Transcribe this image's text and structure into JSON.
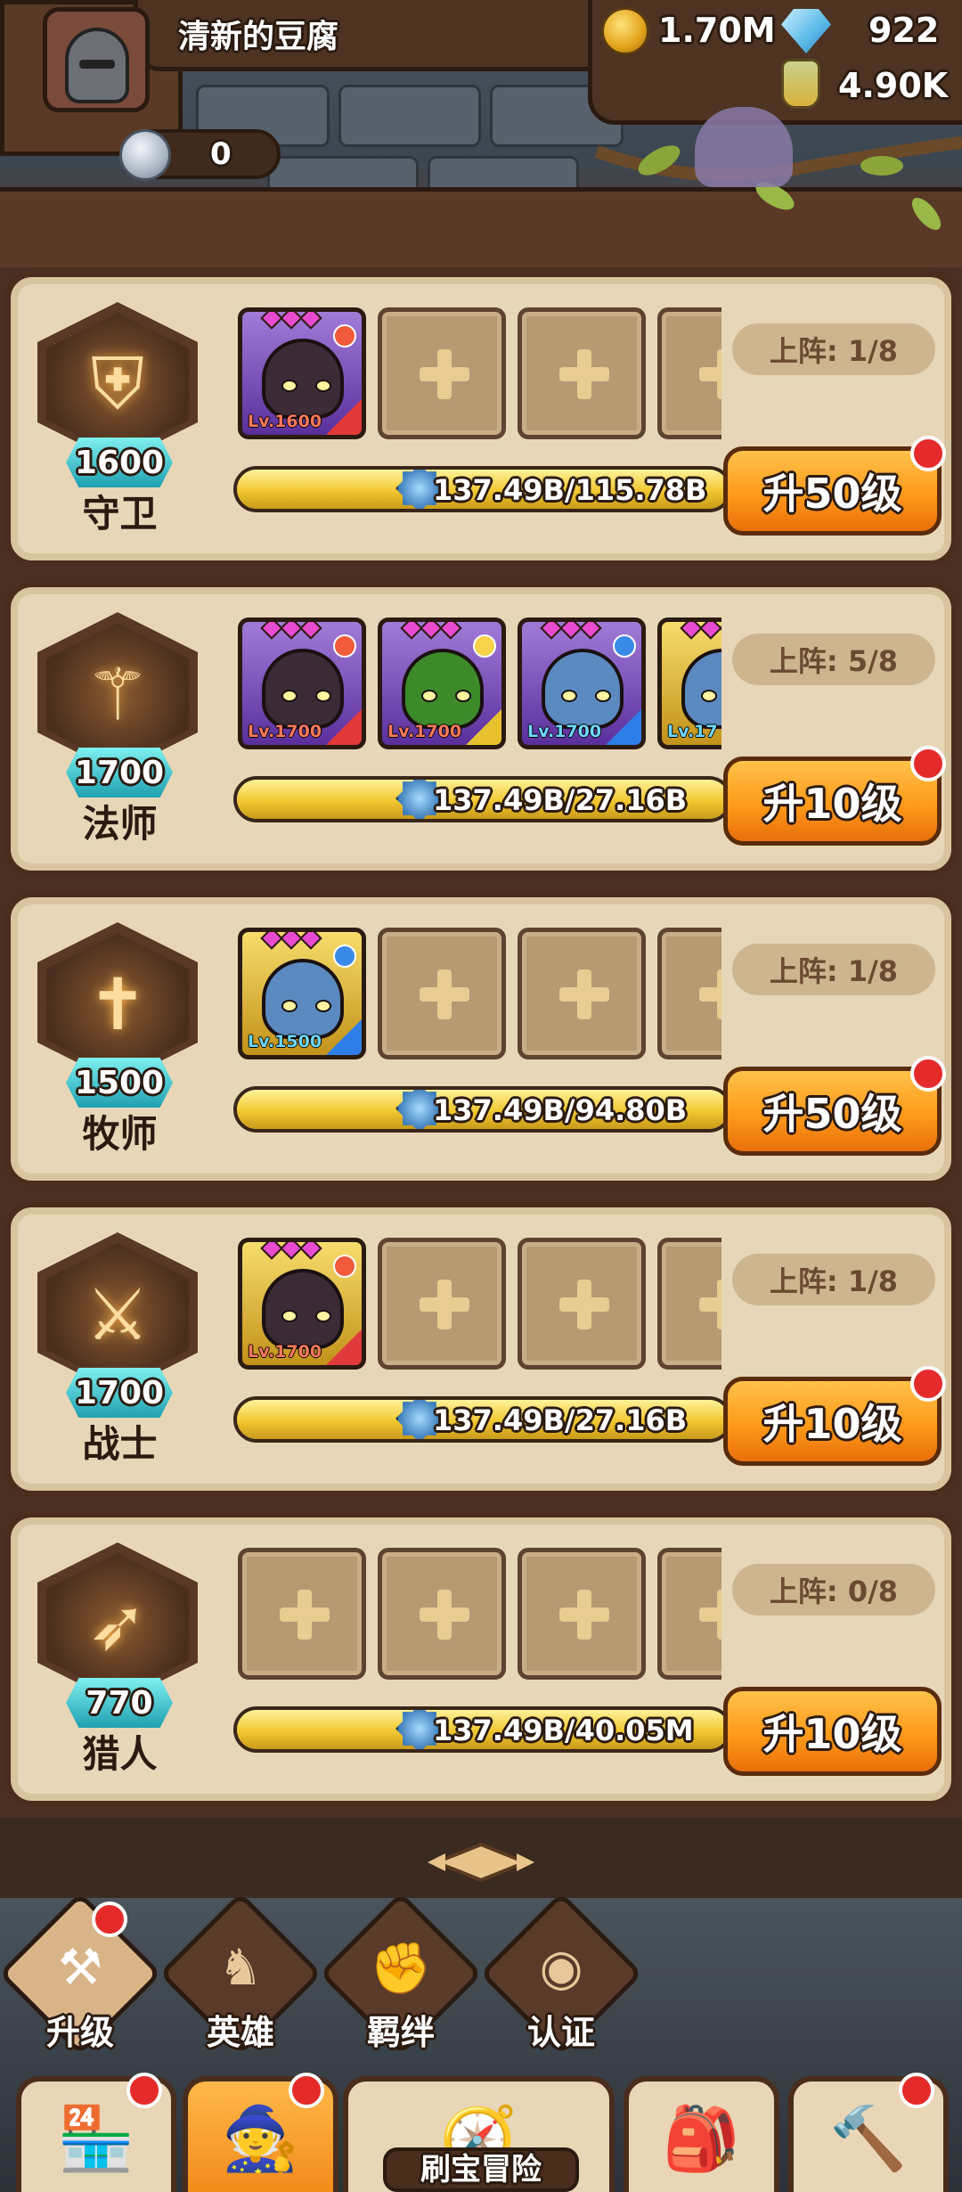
{
  "header": {
    "username": "清新的豆腐",
    "gold": "1.70M",
    "gems": "922",
    "potion": "4.90K",
    "silver": "0"
  },
  "classes": [
    {
      "name": "守卫",
      "level": "1600",
      "icon": "shield-icon",
      "deploy": "上阵: 1/8",
      "progress_text": "137.49B/115.78B",
      "progress_fraction": 1.0,
      "button": "升50级",
      "has_dot": true,
      "heroes": [
        {
          "level": "Lv.1600",
          "rarity": "purple",
          "element": "fire"
        }
      ],
      "empty_slots": 3
    },
    {
      "name": "法师",
      "level": "1700",
      "icon": "staff-icon",
      "deploy": "上阵: 5/8",
      "progress_text": "137.49B/27.16B",
      "progress_fraction": 1.0,
      "button": "升10级",
      "has_dot": true,
      "heroes": [
        {
          "level": "Lv.1700",
          "rarity": "purple",
          "element": "fire"
        },
        {
          "level": "Lv.1700",
          "rarity": "purple",
          "element": "light"
        },
        {
          "level": "Lv.1700",
          "rarity": "purple",
          "element": "water"
        },
        {
          "level": "Lv.17",
          "rarity": "yellow",
          "element": "water"
        }
      ],
      "empty_slots": 0
    },
    {
      "name": "牧师",
      "level": "1500",
      "icon": "cross-icon",
      "deploy": "上阵: 1/8",
      "progress_text": "137.49B/94.80B",
      "progress_fraction": 1.0,
      "button": "升50级",
      "has_dot": true,
      "heroes": [
        {
          "level": "Lv.1500",
          "rarity": "yellow",
          "element": "water"
        }
      ],
      "empty_slots": 3
    },
    {
      "name": "战士",
      "level": "1700",
      "icon": "sword-icon",
      "deploy": "上阵: 1/8",
      "progress_text": "137.49B/27.16B",
      "progress_fraction": 1.0,
      "button": "升10级",
      "has_dot": true,
      "heroes": [
        {
          "level": "Lv.1700",
          "rarity": "yellow",
          "element": "fire"
        }
      ],
      "empty_slots": 3
    },
    {
      "name": "猎人",
      "level": "770",
      "icon": "bow-icon",
      "deploy": "上阵: 0/8",
      "progress_text": "137.49B/40.05M",
      "progress_fraction": 1.0,
      "button": "升10级",
      "has_dot": false,
      "heroes": [],
      "empty_slots": 4
    }
  ],
  "subnav": [
    {
      "label": "升级",
      "icon": "upgrade-icon",
      "has_dot": true
    },
    {
      "label": "英雄",
      "icon": "hero-icon",
      "has_dot": false
    },
    {
      "label": "羁绊",
      "icon": "bond-icon",
      "has_dot": false
    },
    {
      "label": "认证",
      "icon": "eye-icon",
      "has_dot": false
    }
  ],
  "tabs": [
    {
      "icon": "shop-icon",
      "has_dot": true
    },
    {
      "icon": "hero-portrait-icon",
      "has_dot": true,
      "active": true
    },
    {
      "icon": "map-icon",
      "label": "刷宝冒险"
    },
    {
      "icon": "chest-icon",
      "has_dot": false
    },
    {
      "icon": "hammer-icon",
      "has_dot": true
    }
  ]
}
